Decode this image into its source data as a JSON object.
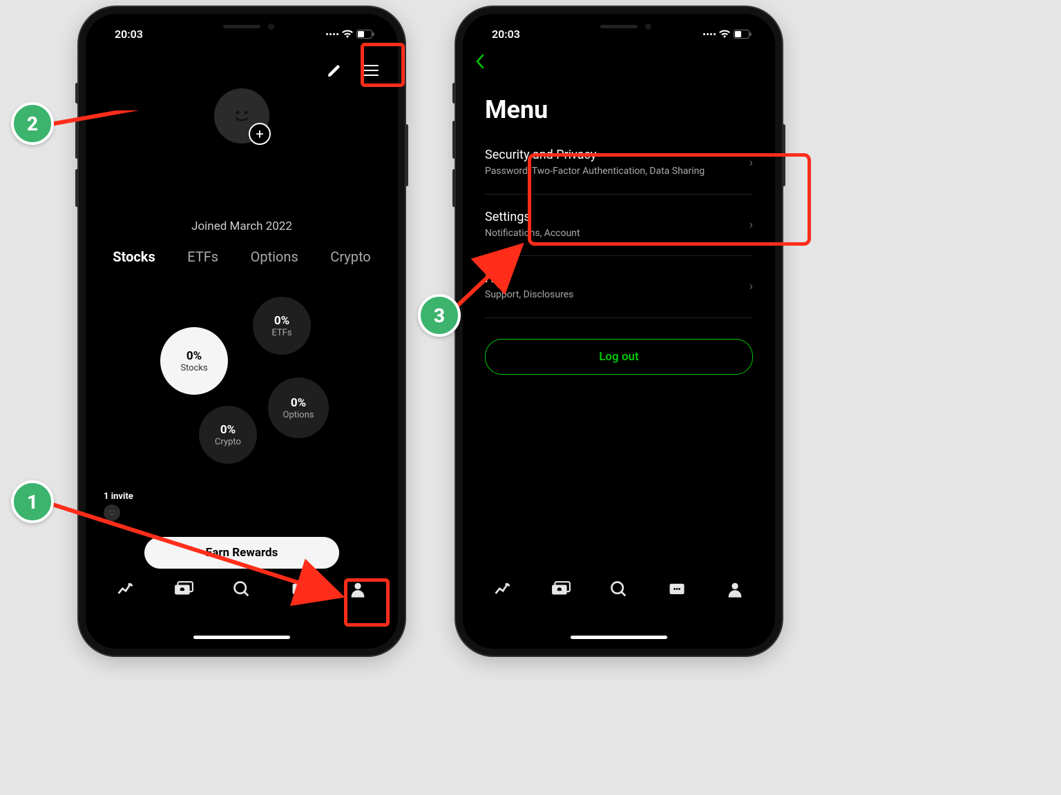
{
  "status": {
    "time": "20:03"
  },
  "screen1": {
    "joined": "Joined March 2022",
    "tabs": {
      "stocks": "Stocks",
      "etfs": "ETFs",
      "options": "Options",
      "crypto": "Crypto"
    },
    "bubbles": {
      "stocks": {
        "pct": "0%",
        "label": "Stocks"
      },
      "etfs": {
        "pct": "0%",
        "label": "ETFs"
      },
      "options": {
        "pct": "0%",
        "label": "Options"
      },
      "crypto": {
        "pct": "0%",
        "label": "Crypto"
      }
    },
    "invite_label": "1 invite",
    "pill": "Earn Rewards"
  },
  "screen2": {
    "title": "Menu",
    "items": [
      {
        "title": "Security and Privacy",
        "sub": "Password, Two-Factor Authentication, Data Sharing"
      },
      {
        "title": "Settings",
        "sub": "Notifications, Account"
      },
      {
        "title": "Help",
        "sub": "Support, Disclosures"
      }
    ],
    "logout": "Log out"
  },
  "steps": {
    "1": "1",
    "2": "2",
    "3": "3"
  }
}
